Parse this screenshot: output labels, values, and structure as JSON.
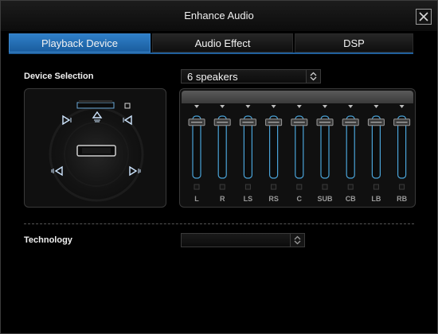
{
  "window": {
    "title": "Enhance Audio"
  },
  "tabs": [
    {
      "label": "Playback Device",
      "active": true
    },
    {
      "label": "Audio Effect",
      "active": false
    },
    {
      "label": "DSP",
      "active": false
    }
  ],
  "device_selection": {
    "label": "Device Selection",
    "value": "6 speakers"
  },
  "channels": [
    {
      "label": "L",
      "level": 0.9
    },
    {
      "label": "R",
      "level": 0.9
    },
    {
      "label": "LS",
      "level": 0.9
    },
    {
      "label": "RS",
      "level": 0.9
    },
    {
      "label": "C",
      "level": 0.9
    },
    {
      "label": "SUB",
      "level": 0.9
    },
    {
      "label": "CB",
      "level": 0.9
    },
    {
      "label": "LB",
      "level": 0.9
    },
    {
      "label": "RB",
      "level": 0.9
    }
  ],
  "technology": {
    "label": "Technology",
    "value": ""
  },
  "colors": {
    "accent": "#2f7fc8",
    "slider_track": "#4aa3d8"
  }
}
